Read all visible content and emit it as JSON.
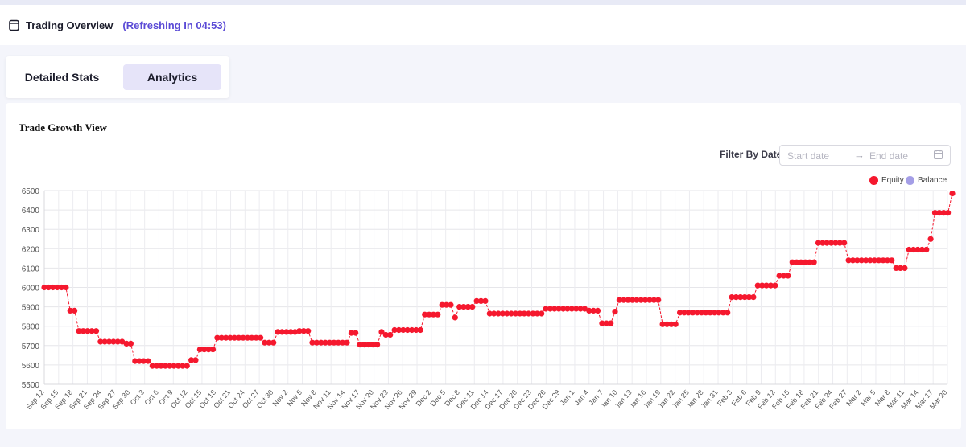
{
  "header": {
    "title": "Trading Overview",
    "refresh_text": "(Refreshing In 04:53)"
  },
  "tabs": [
    {
      "label": "Detailed Stats",
      "active": false
    },
    {
      "label": "Analytics",
      "active": true
    }
  ],
  "card": {
    "title": "Trade Growth View",
    "filter_label": "Filter By Date:",
    "start_placeholder": "Start date",
    "end_placeholder": "End date"
  },
  "colors": {
    "equity": "#f5182e",
    "balance": "#a49ee6",
    "accent": "#5b4bd6",
    "active_tab": "#e6e4f9"
  },
  "chart_data": {
    "type": "scatter",
    "title": "",
    "xlabel": "",
    "ylabel": "",
    "ylim": [
      5500,
      6500
    ],
    "yticks": [
      5500,
      5600,
      5700,
      5800,
      5900,
      6000,
      6100,
      6200,
      6300,
      6400,
      6500
    ],
    "grid": true,
    "legend_position": "top-right",
    "legend": [
      "Equity",
      "Balance"
    ],
    "x_labels": [
      "Sep 12",
      "Sep 15",
      "Sep 18",
      "Sep 21",
      "Sep 24",
      "Sep 27",
      "Sep 30",
      "Oct 3",
      "Oct 6",
      "Oct 9",
      "Oct 12",
      "Oct 15",
      "Oct 18",
      "Oct 21",
      "Oct 24",
      "Oct 27",
      "Oct 30",
      "Nov 2",
      "Nov 5",
      "Nov 8",
      "Nov 11",
      "Nov 14",
      "Nov 17",
      "Nov 20",
      "Nov 23",
      "Nov 26",
      "Nov 29",
      "Dec 2",
      "Dec 5",
      "Dec 8",
      "Dec 11",
      "Dec 14",
      "Dec 17",
      "Dec 20",
      "Dec 23",
      "Dec 26",
      "Dec 29",
      "Jan 1",
      "Jan 4",
      "Jan 7",
      "Jan 10",
      "Jan 13",
      "Jan 16",
      "Jan 19",
      "Jan 22",
      "Jan 25",
      "Jan 28",
      "Jan 31",
      "Feb 3",
      "Feb 6",
      "Feb 9",
      "Feb 12",
      "Feb 15",
      "Feb 18",
      "Feb 21",
      "Feb 24",
      "Feb 27",
      "Mar 2",
      "Mar 5",
      "Mar 8",
      "Mar 11",
      "Mar 14",
      "Mar 17",
      "Mar 20"
    ],
    "series": [
      {
        "name": "Equity",
        "style": "points-dashed",
        "values": [
          6000,
          6000,
          6000,
          6000,
          6000,
          6000,
          5880,
          5880,
          5775,
          5775,
          5775,
          5775,
          5775,
          5720,
          5720,
          5720,
          5720,
          5720,
          5720,
          5710,
          5710,
          5620,
          5620,
          5620,
          5620,
          5595,
          5595,
          5595,
          5595,
          5595,
          5595,
          5595,
          5595,
          5595,
          5625,
          5625,
          5680,
          5680,
          5680,
          5680,
          5740,
          5740,
          5740,
          5740,
          5740,
          5740,
          5740,
          5740,
          5740,
          5740,
          5740,
          5715,
          5715,
          5715,
          5770,
          5770,
          5770,
          5770,
          5770,
          5775,
          5775,
          5775,
          5715,
          5715,
          5715,
          5715,
          5715,
          5715,
          5715,
          5715,
          5715,
          5765,
          5765,
          5705,
          5705,
          5705,
          5705,
          5705,
          5770,
          5755,
          5755,
          5780,
          5780,
          5780,
          5780,
          5780,
          5780,
          5780,
          5860,
          5860,
          5860,
          5860,
          5910,
          5910,
          5910,
          5845,
          5900,
          5900,
          5900,
          5900,
          5930,
          5930,
          5930,
          5865,
          5865,
          5865,
          5865,
          5865,
          5865,
          5865,
          5865,
          5865,
          5865,
          5865,
          5865,
          5865,
          5890,
          5890,
          5890,
          5890,
          5890,
          5890,
          5890,
          5890,
          5890,
          5890,
          5880,
          5880,
          5880,
          5815,
          5815,
          5815,
          5875,
          5935,
          5935,
          5935,
          5935,
          5935,
          5935,
          5935,
          5935,
          5935,
          5935,
          5810,
          5810,
          5810,
          5810,
          5870,
          5870,
          5870,
          5870,
          5870,
          5870,
          5870,
          5870,
          5870,
          5870,
          5870,
          5870,
          5950,
          5950,
          5950,
          5950,
          5950,
          5950,
          6010,
          6010,
          6010,
          6010,
          6010,
          6060,
          6060,
          6060,
          6130,
          6130,
          6130,
          6130,
          6130,
          6130,
          6230,
          6230,
          6230,
          6230,
          6230,
          6230,
          6230,
          6140,
          6140,
          6140,
          6140,
          6140,
          6140,
          6140,
          6140,
          6140,
          6140,
          6140,
          6100,
          6100,
          6100,
          6195,
          6195,
          6195,
          6195,
          6195,
          6250,
          6385,
          6385,
          6385,
          6385,
          6485
        ]
      },
      {
        "name": "Balance",
        "values": []
      }
    ]
  }
}
